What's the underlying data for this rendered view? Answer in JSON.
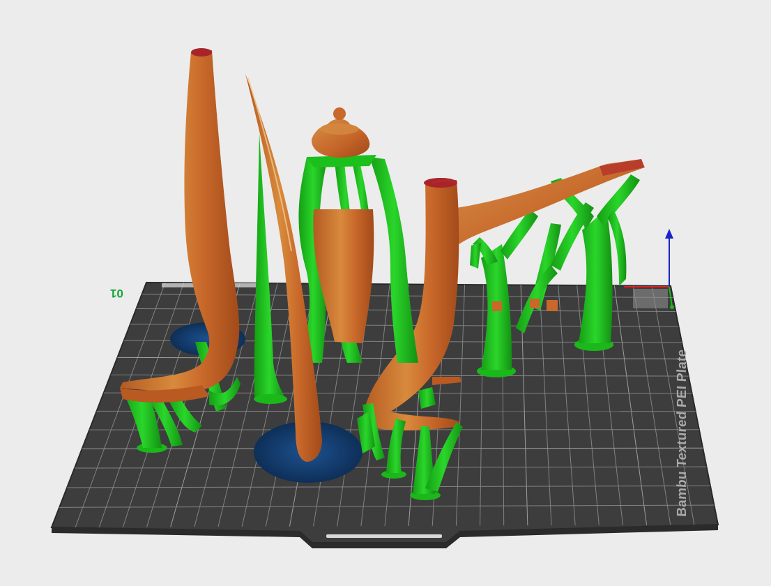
{
  "app": {
    "plate_label": "Bambu Textured PEI Plate",
    "plate_number": "01"
  },
  "colors": {
    "background": "#ececec",
    "plate": "#3c3c3c",
    "plate_border": "#5a5a5a",
    "grid_line": "#8a8a8a",
    "model_orange": "#c8682a",
    "model_highlight": "#e0a050",
    "support_green": "#21cf21",
    "support_green_dark": "#139e13",
    "brim_blue": "#123c6b",
    "axis_x": "#e02020",
    "axis_y": "#18b818",
    "axis_z": "#1a24c8"
  },
  "scene": {
    "objects": [
      "tall-tapered-tower",
      "curved-horn",
      "domed-vase",
      "leaning-ramp",
      "small-cubes"
    ],
    "supports": "tree-supports",
    "brims": "blue-brim-discs"
  }
}
